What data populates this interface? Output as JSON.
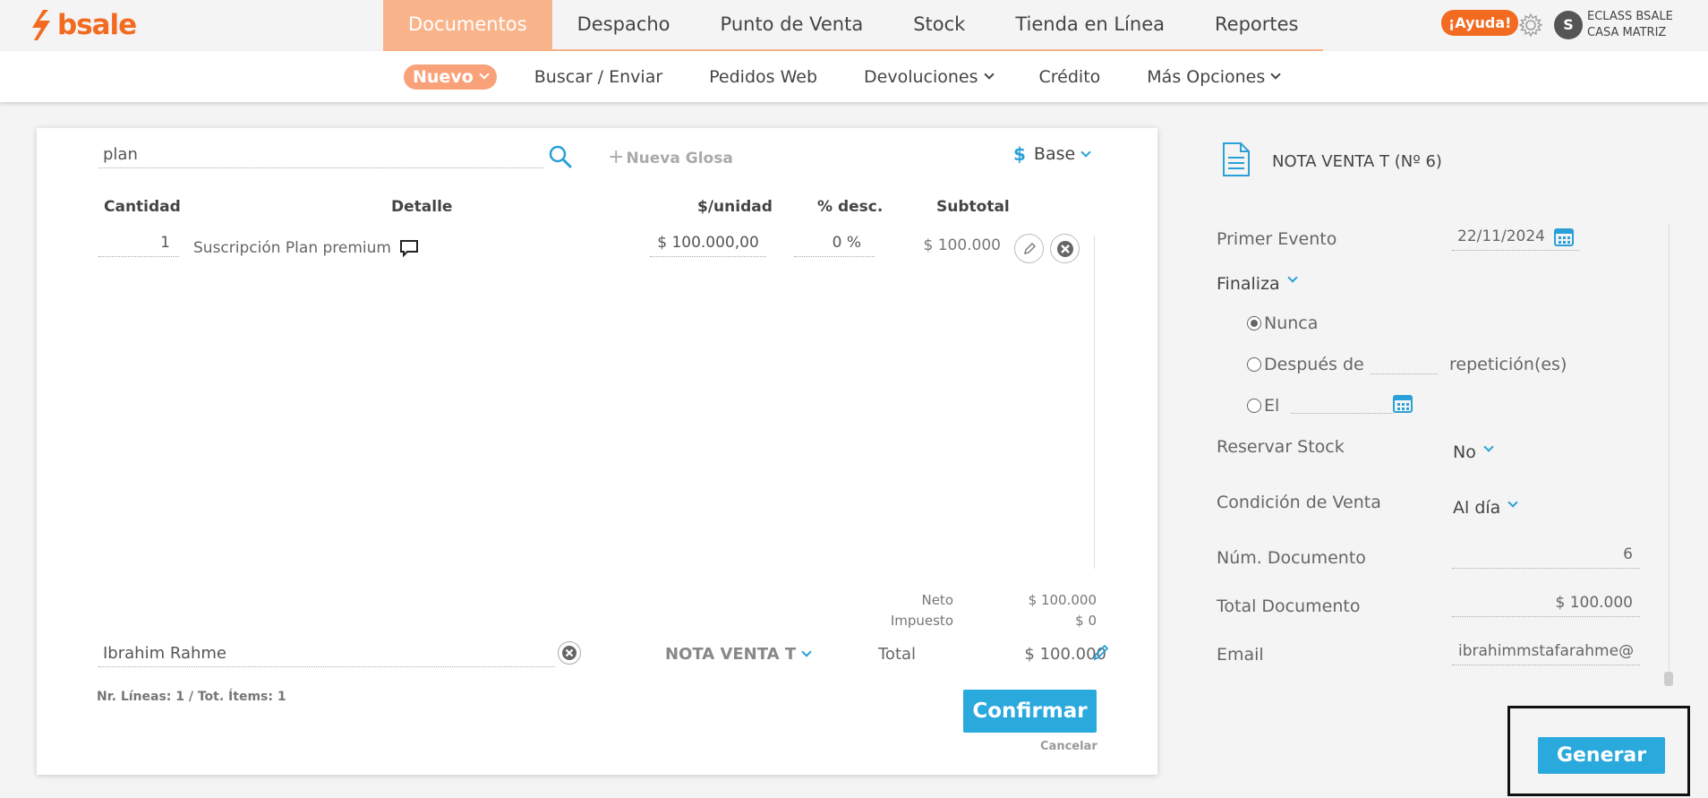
{
  "brand": {
    "name": "bsale",
    "color": "#f26b21"
  },
  "nav": {
    "items": [
      "Documentos",
      "Despacho",
      "Punto de Venta",
      "Stock",
      "Tienda en Línea",
      "Reportes"
    ],
    "active": "Documentos",
    "help_label": "¡Ayuda!",
    "avatar_initial": "S",
    "company_line1": "ECLASS BSALE",
    "company_line2": "CASA MATRIZ"
  },
  "subnav": {
    "nuevo": "Nuevo",
    "buscar": "Buscar / Enviar",
    "pedidos": "Pedidos Web",
    "devoluciones": "Devoluciones",
    "credito": "Crédito",
    "mas": "Más Opciones"
  },
  "editor": {
    "search_value": "plan",
    "nueva_glosa": "Nueva Glosa",
    "price_list_symbol": "$",
    "price_list": "Base",
    "headers": {
      "cantidad": "Cantidad",
      "detalle": "Detalle",
      "unidad": "$/unidad",
      "desc": "% desc.",
      "subtotal": "Subtotal"
    },
    "rows": [
      {
        "qty": "1",
        "detail": "Suscripción Plan premium",
        "unit_price": "$ 100.000,00",
        "discount": "0 %",
        "subtotal": "$ 100.000"
      }
    ],
    "totals": {
      "neto_label": "Neto",
      "neto": "$ 100.000",
      "impuesto_label": "Impuesto",
      "impuesto": "$ 0",
      "total_label": "Total",
      "total": "$ 100.000"
    },
    "client": "Ibrahim Rahme",
    "doc_type": "NOTA VENTA T",
    "summary": "Nr. Líneas: 1 / Tot. Ítems: 1",
    "confirm_label": "Confirmar",
    "cancel_label": "Cancelar"
  },
  "panel": {
    "title": "NOTA VENTA T (Nº 6)",
    "primer_evento_label": "Primer Evento",
    "primer_evento": "22/11/2024",
    "finaliza_label": "Finaliza",
    "nunca_label": "Nunca",
    "despues_label": "Después de",
    "repeticiones_label": "repetición(es)",
    "el_label": "El",
    "reservar_label": "Reservar Stock",
    "reservar_value": "No",
    "condicion_label": "Condición de Venta",
    "condicion_value": "Al día",
    "num_doc_label": "Núm. Documento",
    "num_doc": "6",
    "total_doc_label": "Total Documento",
    "total_doc": "$ 100.000",
    "email_label": "Email",
    "email": "ibrahimmstafarahme@",
    "generate_label": "Generar"
  },
  "colors": {
    "accent": "#2aa9dd",
    "nav_active": "#f9b48b",
    "brand": "#f26b21"
  }
}
